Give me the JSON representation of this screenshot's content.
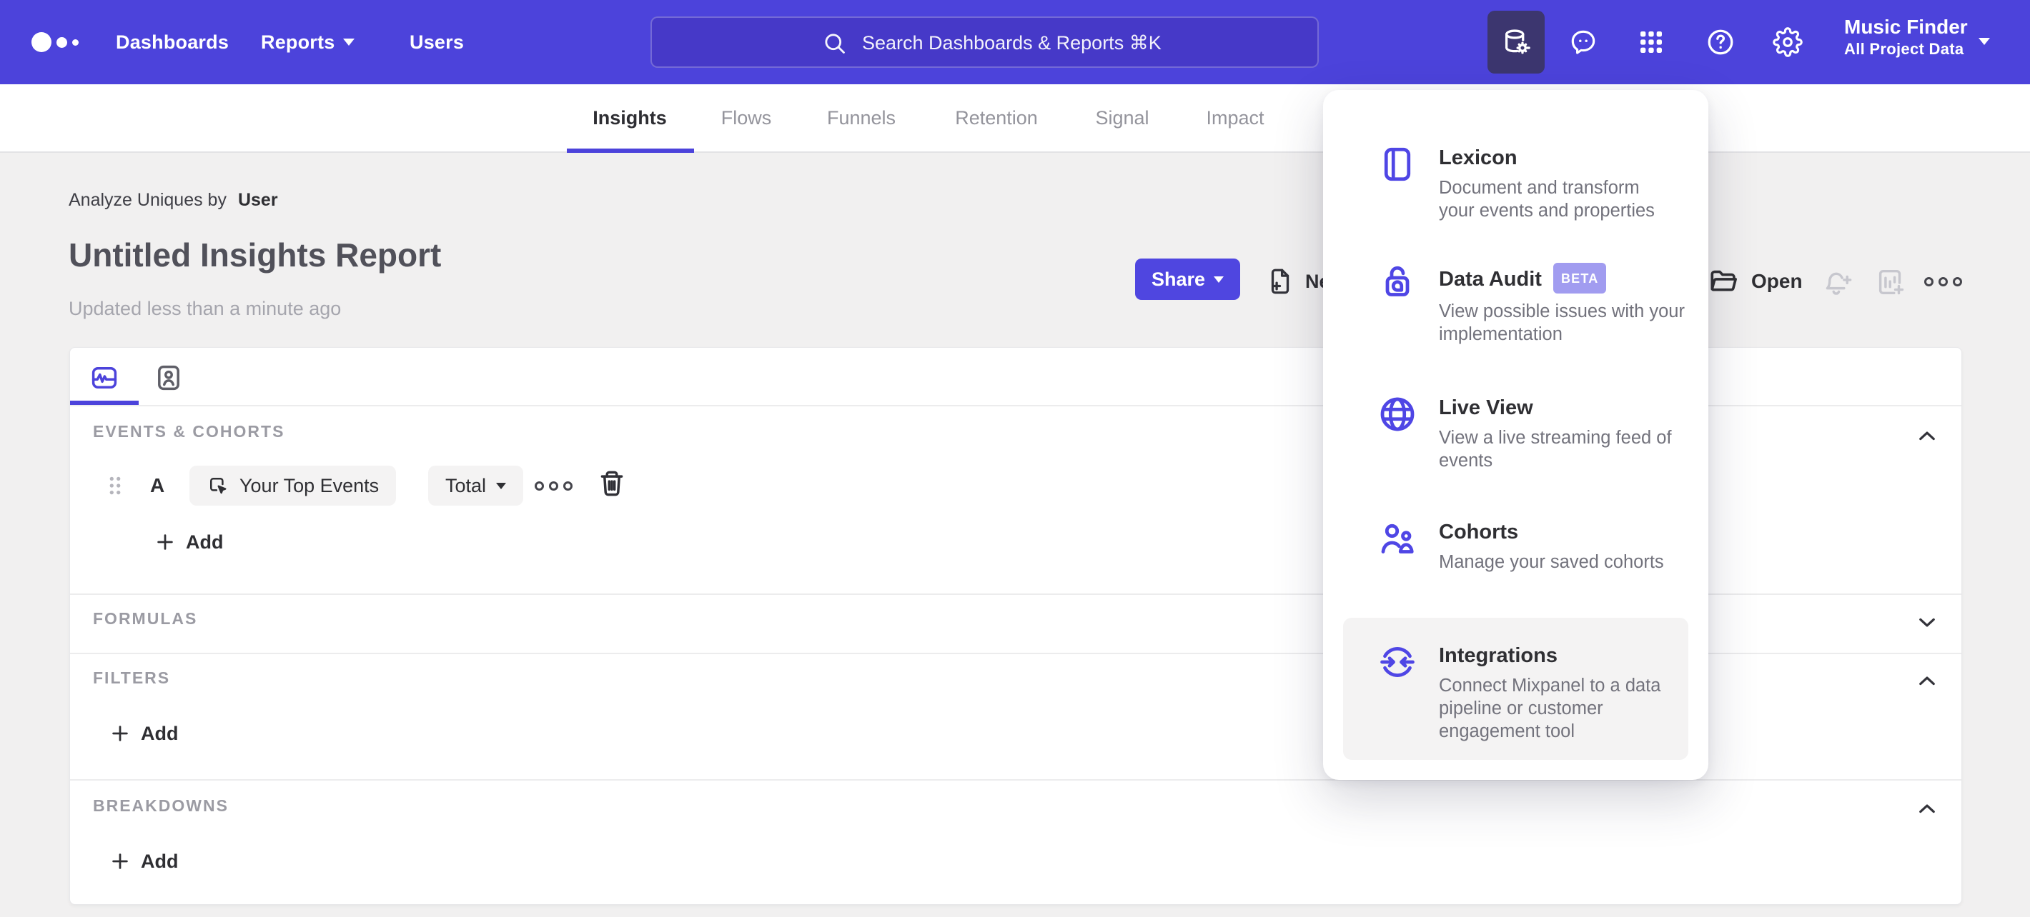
{
  "nav": {
    "items": [
      "Dashboards",
      "Reports",
      "Users"
    ],
    "search_placeholder": "Search Dashboards & Reports ⌘K",
    "project": {
      "name": "Music Finder",
      "subtitle": "All Project Data"
    }
  },
  "report_tabs": [
    "Insights",
    "Flows",
    "Funnels",
    "Retention",
    "Signal",
    "Impact"
  ],
  "report": {
    "breadcrumb": {
      "prefix": "Analyze Uniques by",
      "value": "User"
    },
    "title": "Untitled Insights Report",
    "updated": "Updated less than a minute ago"
  },
  "actions": {
    "share": "Share",
    "new": "New",
    "open": "Open"
  },
  "builder": {
    "events": {
      "label": "EVENTS & COHORTS",
      "add_label": "Add",
      "row": {
        "id": "A",
        "event": "Your Top Events",
        "aggregation": "Total"
      }
    },
    "formulas": {
      "label": "FORMULAS"
    },
    "filters": {
      "label": "FILTERS",
      "add_label": "Add"
    },
    "breakdowns": {
      "label": "BREAKDOWNS",
      "add_label": "Add"
    }
  },
  "menu": {
    "items": [
      {
        "title": "Lexicon",
        "description": [
          "Document and transform",
          "your events and properties"
        ]
      },
      {
        "title": "Data Audit",
        "badge": "BETA",
        "description": [
          "View possible issues with your",
          "implementation"
        ]
      },
      {
        "title": "Live View",
        "description": [
          "View a live streaming feed of",
          "events"
        ]
      },
      {
        "title": "Cohorts",
        "description": [
          "Manage your saved cohorts"
        ]
      },
      {
        "title": "Integrations",
        "highlighted": true,
        "description": [
          "Connect Mixpanel to a data",
          "pipeline or customer",
          "engagement tool"
        ]
      }
    ]
  },
  "colors": {
    "nav_bg": "#4C43DB",
    "accent_button": "#4F46E0",
    "icon_accent": "#4F46E5",
    "beta_badge": "#A19CF0",
    "active_tile_bg": "#3C366F",
    "page_bg": "#F1F0F0",
    "tab_underline": "#4C43DB",
    "disabled_icon": "#C7C7CE"
  }
}
